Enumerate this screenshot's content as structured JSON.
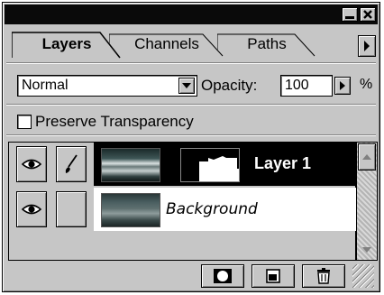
{
  "tabs": [
    {
      "label": "Layers"
    },
    {
      "label": "Channels"
    },
    {
      "label": "Paths"
    }
  ],
  "blend_mode": {
    "value": "Normal"
  },
  "opacity": {
    "label": "Opacity:",
    "value": "100",
    "unit": "%"
  },
  "preserve_transparency": {
    "label": "Preserve Transparency",
    "checked": false
  },
  "layers": [
    {
      "name": "Layer 1",
      "selected": true,
      "visible": true,
      "has_mask": true
    },
    {
      "name": "Background",
      "selected": false,
      "visible": true,
      "has_mask": false
    }
  ],
  "icons": {
    "minimize": "minimize-icon",
    "close": "close-icon",
    "panel_menu": "menu-arrow-icon",
    "eye": "eye-icon",
    "brush": "brush-icon",
    "mask": "add-mask-icon",
    "new_layer": "new-layer-icon",
    "trash": "trash-icon"
  },
  "colors": {
    "panel": "#c6c6c6",
    "selected_row": "#000000",
    "title_bar": "#0a0a0a"
  }
}
